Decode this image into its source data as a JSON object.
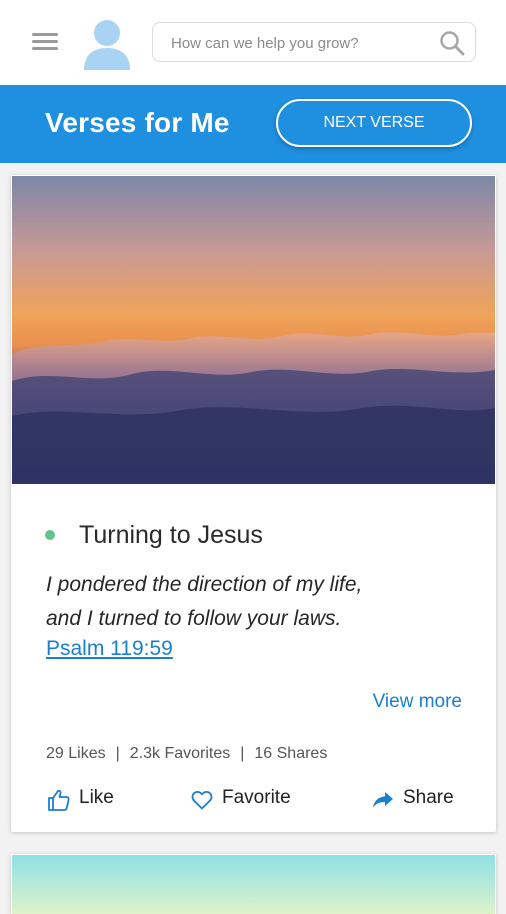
{
  "search": {
    "placeholder": "How can we help you grow?"
  },
  "header": {
    "title": "Verses for Me",
    "next_button": "NEXT VERSE"
  },
  "card": {
    "title": "Turning to Jesus",
    "verse_lines": [
      "I pondered the direction of my life,",
      "and I turned to follow your laws."
    ],
    "reference": "Psalm 119:59",
    "view_more": "View more",
    "stats": {
      "likes": "29 Likes",
      "favorites": "2.3k Favorites",
      "shares": "16 Shares",
      "separator": "|"
    },
    "actions": {
      "like": "Like",
      "favorite": "Favorite",
      "share": "Share"
    }
  },
  "icons": {
    "menu": "hamburger-menu-icon",
    "avatar": "user-avatar-icon",
    "search": "search-icon",
    "like": "thumbs-up-icon",
    "favorite": "heart-icon",
    "share": "share-arrow-icon"
  },
  "colors": {
    "accent": "#1f8fe0",
    "link": "#1a7fd0",
    "status_dot": "#5fc58b"
  }
}
